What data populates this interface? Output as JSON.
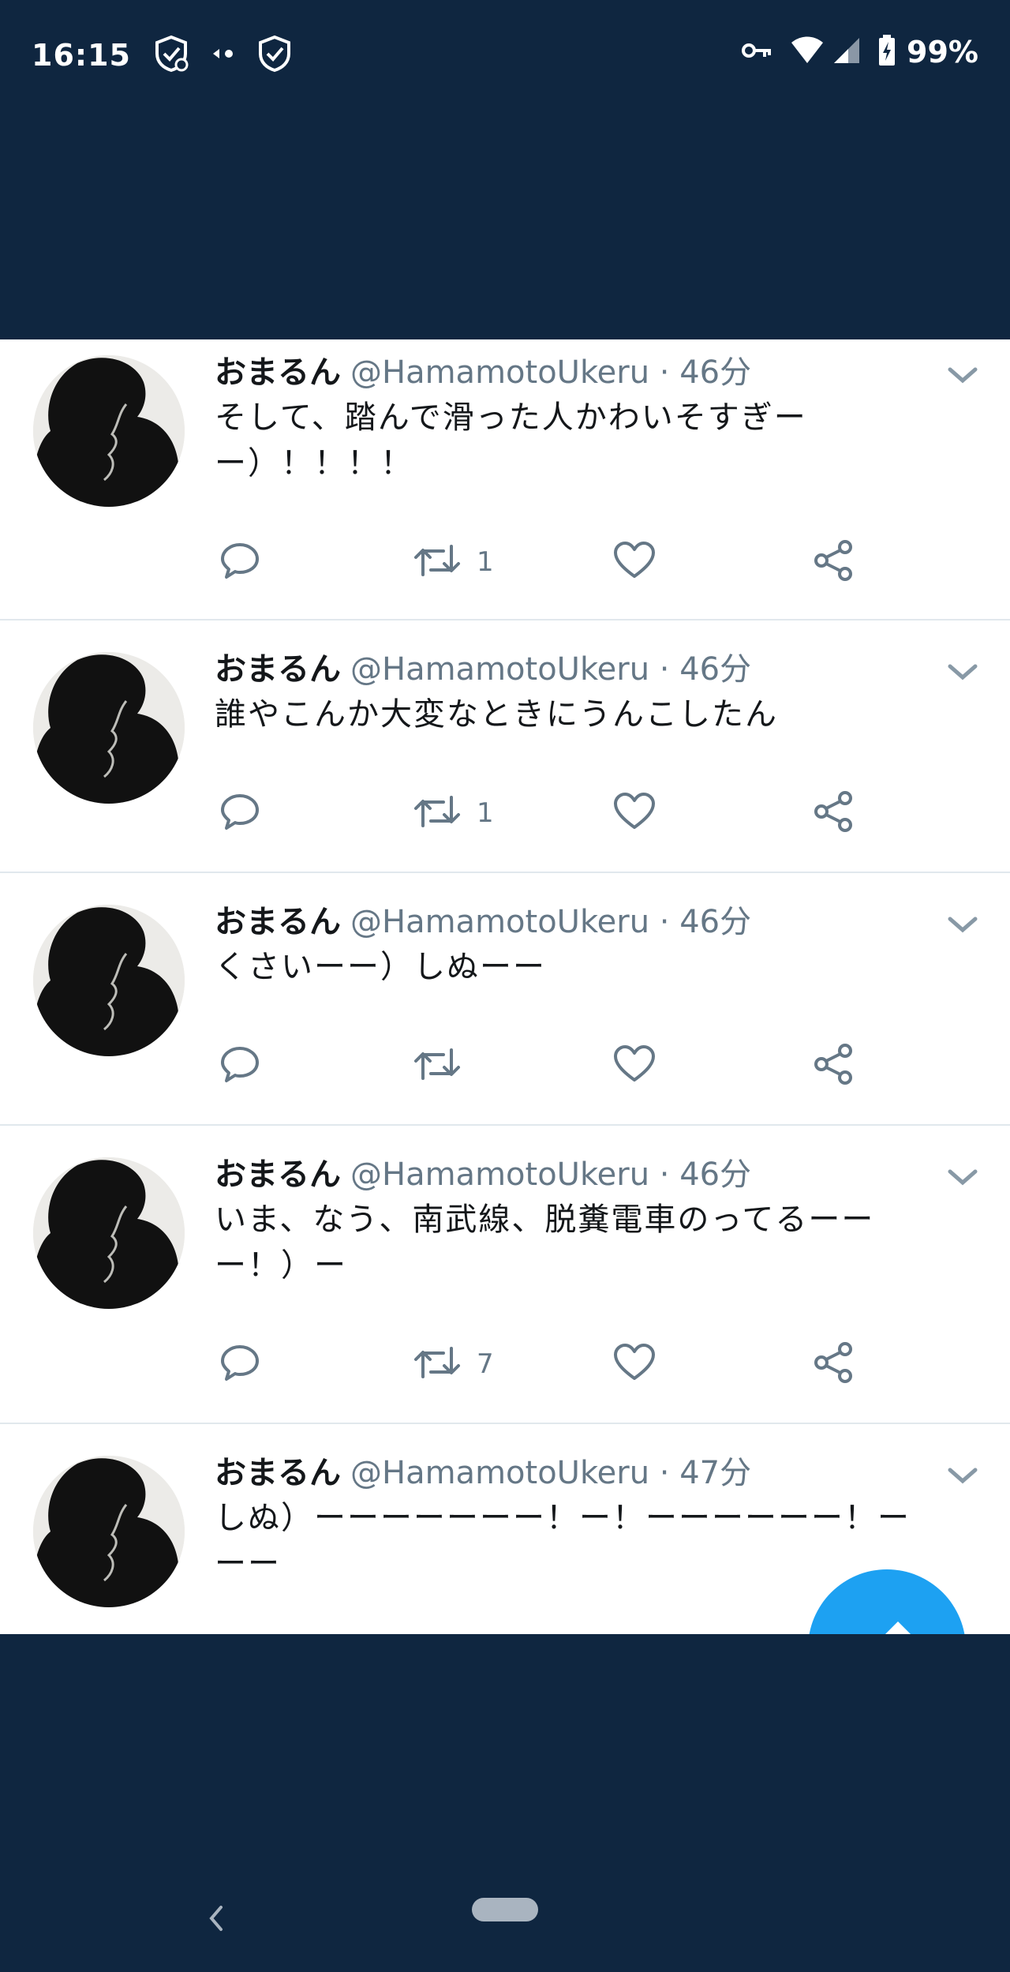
{
  "status_bar": {
    "time": "16:15",
    "battery": "99%",
    "left_icons": [
      "shield-sync-icon",
      "data-saver-icon",
      "shield-check-icon"
    ],
    "right_icons": [
      "vpn-key-icon",
      "wifi-icon",
      "signal-icon",
      "battery-charging-icon"
    ]
  },
  "colors": {
    "header_background": "#0f2640",
    "feed_background": "#ffffff",
    "name": "#14171a",
    "secondary_text": "#657786",
    "fab": "#1da1f2"
  },
  "tweets": [
    {
      "name": "おまるん",
      "handle": "@HamamotoUkeru · 46分",
      "text_lines": [
        "そして、踏んで滑った人かわいそすぎー",
        "ー）！！！！"
      ],
      "retweets": "1"
    },
    {
      "name": "おまるん",
      "handle": "@HamamotoUkeru · 46分",
      "text_lines": [
        "誰やこんか大変なときにうんこしたん"
      ],
      "retweets": "1"
    },
    {
      "name": "おまるん",
      "handle": "@HamamotoUkeru · 46分",
      "text_lines": [
        "くさいーー）しぬーー"
      ],
      "retweets": ""
    },
    {
      "name": "おまるん",
      "handle": "@HamamotoUkeru · 46分",
      "text_lines": [
        "いま、なう、南武線、脱糞電車のってるーー",
        "ー！）ー"
      ],
      "retweets": "7"
    },
    {
      "name": "おまるん",
      "handle": "@HamamotoUkeru · 47分",
      "text_lines": [
        "しぬ）ーーーーーーー！ー！ーーーーーー！ー",
        "ーー"
      ],
      "retweets": ""
    }
  ],
  "action_icons": [
    "reply-icon",
    "retweet-icon",
    "like-icon",
    "share-icon"
  ],
  "fab_icon": "compose-icon",
  "nav_bar": {
    "icons": [
      "back-chevron-icon",
      "home-pill"
    ]
  }
}
